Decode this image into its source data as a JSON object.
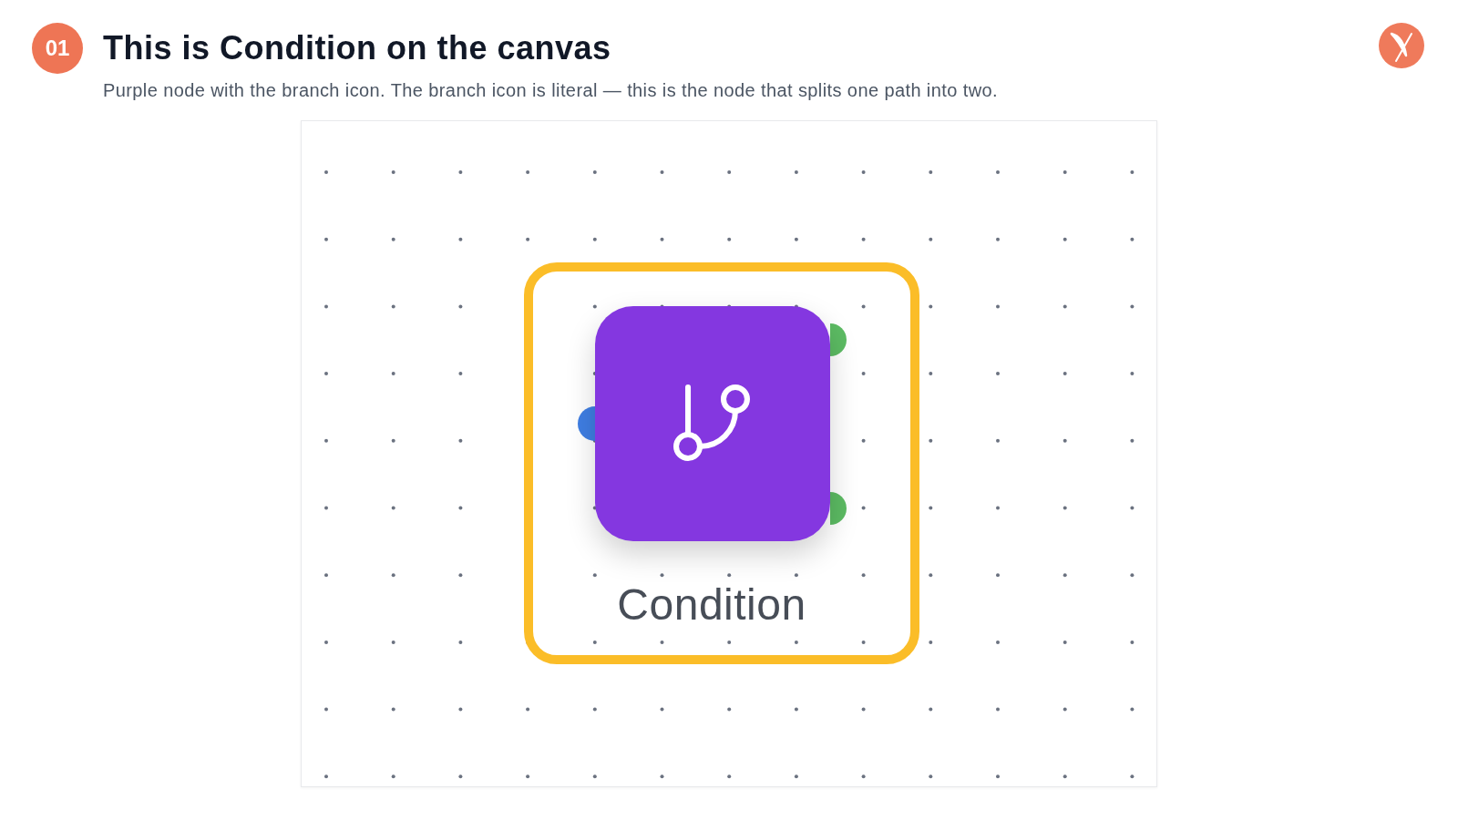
{
  "header": {
    "step": "01",
    "title": "This is Condition on the canvas",
    "description": "Purple node with the branch icon. The branch icon is literal — this is the node that splits one path into two."
  },
  "canvas": {
    "node": {
      "label": "Condition",
      "highlighted": true,
      "ports": [
        {
          "kind": "input",
          "color": "#3f7ee3"
        },
        {
          "kind": "output",
          "color": "#5cbb63"
        },
        {
          "kind": "output",
          "color": "#5cbb63"
        }
      ]
    }
  }
}
